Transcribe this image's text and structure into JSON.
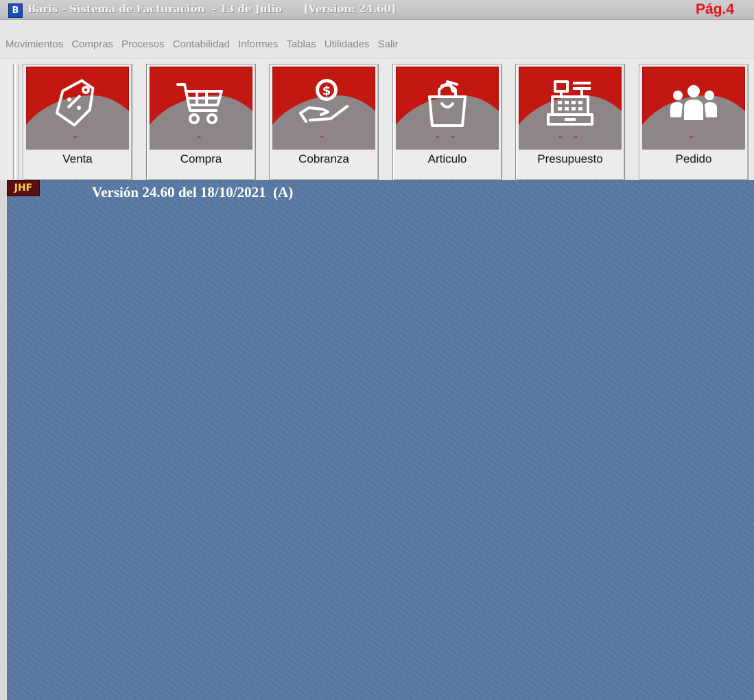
{
  "window": {
    "app_icon_letter": "B",
    "title": "Baris - Sistema de Facturación  - 13 de Julio      [Version: 24.60]",
    "page_label": "Pág.4"
  },
  "menu": {
    "items": [
      "Movimientos",
      "Compras",
      "Procesos",
      "Contabilidad",
      "Informes",
      "Tablas",
      "Utilidades",
      "Salir"
    ]
  },
  "toolbar": {
    "buttons": [
      {
        "label": "Venta",
        "icon": "price-tag-icon"
      },
      {
        "label": "Compra",
        "icon": "shopping-cart-icon"
      },
      {
        "label": "Cobranza",
        "icon": "hand-coin-icon"
      },
      {
        "label": "Articulo",
        "icon": "shopping-bag-icon"
      },
      {
        "label": "Presupuesto",
        "icon": "cash-register-icon"
      },
      {
        "label": "Pedido",
        "icon": "group-people-icon"
      }
    ]
  },
  "main": {
    "badge": "JHF",
    "version_text": "Versión 24.60 del 18/10/2021  (A)",
    "background_color": "#5878a2"
  }
}
